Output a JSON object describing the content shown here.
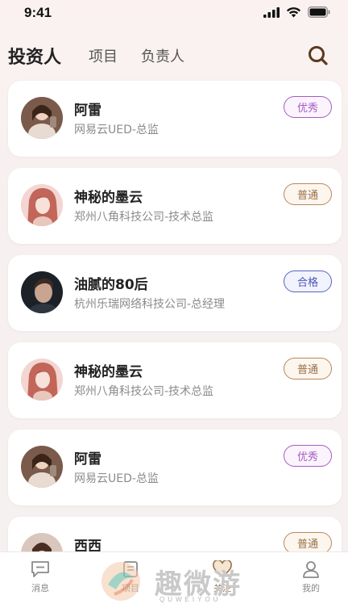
{
  "status_bar": {
    "time": "9:41"
  },
  "header": {
    "tabs": [
      {
        "label": "投资人",
        "active": true
      },
      {
        "label": "项目",
        "active": false
      },
      {
        "label": "负责人",
        "active": false
      }
    ],
    "search_icon": "search-icon"
  },
  "investors": [
    {
      "name": "阿雷",
      "title": "网易云UED-总监",
      "badge": "优秀",
      "badge_color": "#a45bc2",
      "avatar": "female-photo"
    },
    {
      "name": "神秘的墨云",
      "title": "郑州八角科技公司-技术总监",
      "badge": "普通",
      "badge_color": "#b7895a",
      "avatar": "anime-girl"
    },
    {
      "name": "油腻的80后",
      "title": "杭州乐瑞网络科技公司-总经理",
      "badge": "合格",
      "badge_color": "#5a63c2",
      "avatar": "male-photo"
    },
    {
      "name": "神秘的墨云",
      "title": "郑州八角科技公司-技术总监",
      "badge": "普通",
      "badge_color": "#b7895a",
      "avatar": "anime-girl"
    },
    {
      "name": "阿雷",
      "title": "网易云UED-总监",
      "badge": "优秀",
      "badge_color": "#a45bc2",
      "avatar": "female-photo"
    },
    {
      "name": "西西",
      "title": "",
      "badge": "普通",
      "badge_color": "#b7895a",
      "avatar": "female-photo"
    }
  ],
  "bottom_nav": {
    "items": [
      {
        "label": "消息",
        "icon": "message-icon"
      },
      {
        "label": "项目",
        "icon": "project-icon"
      },
      {
        "label": "关注",
        "icon": "heart-icon"
      },
      {
        "label": "我的",
        "icon": "user-icon"
      }
    ]
  },
  "watermark": {
    "text": "趣微游",
    "sub": "QUWEIYOU"
  }
}
